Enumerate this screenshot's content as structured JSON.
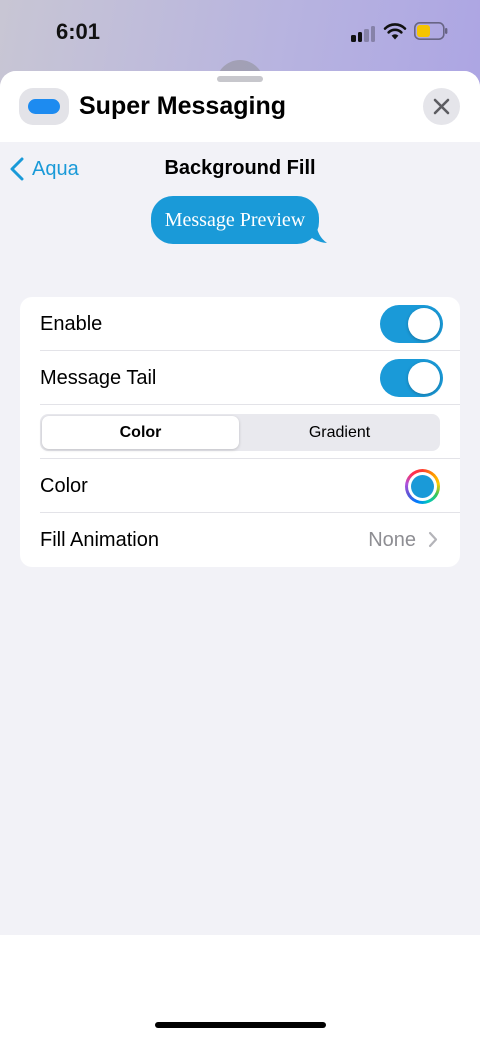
{
  "status_bar": {
    "time": "6:01",
    "battery_color": "#f5c400"
  },
  "sheet": {
    "app_title": "Super Messaging",
    "app_icon": "message-bubble-icon",
    "close_icon": "close-icon"
  },
  "nav": {
    "back_label": "Aqua",
    "title": "Background Fill"
  },
  "preview": {
    "text": "Message Preview",
    "bubble_color": "#1a9ad8"
  },
  "settings": {
    "enable_label": "Enable",
    "enable_on": true,
    "message_tail_label": "Message Tail",
    "message_tail_on": true,
    "fill_type": {
      "options": [
        "Color",
        "Gradient"
      ],
      "selected": "Color"
    },
    "color_label": "Color",
    "color_value": "#1a9ad8",
    "fill_animation_label": "Fill Animation",
    "fill_animation_value": "None"
  },
  "colors": {
    "accent": "#1a9ad8",
    "background": "#f2f2f7",
    "secondary_text": "#8e8e93"
  }
}
